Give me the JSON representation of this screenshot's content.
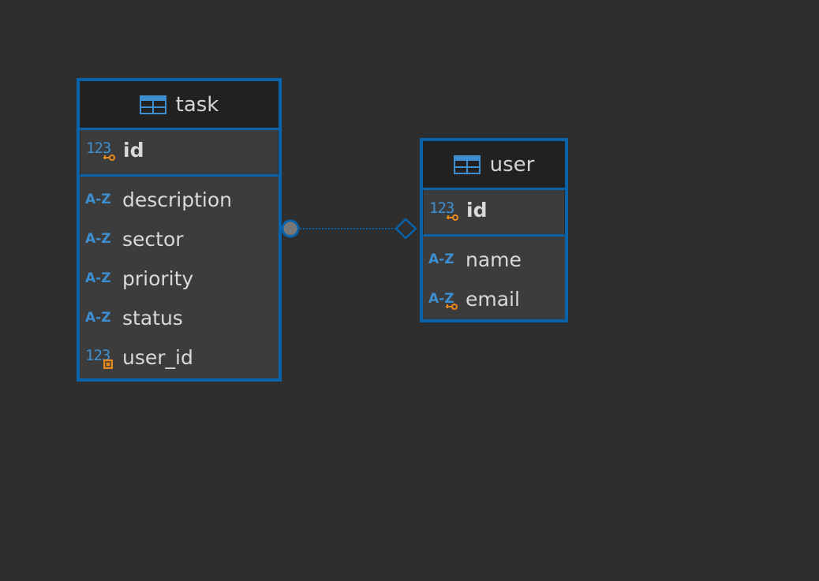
{
  "entities": {
    "task": {
      "name": "task",
      "pk": {
        "name": "id",
        "icon": "numeric-key-icon"
      },
      "columns": [
        {
          "name": "description",
          "icon": "text-type-icon"
        },
        {
          "name": "sector",
          "icon": "text-type-icon"
        },
        {
          "name": "priority",
          "icon": "text-type-icon"
        },
        {
          "name": "status",
          "icon": "text-type-icon"
        },
        {
          "name": "user_id",
          "icon": "numeric-foreign-key-icon"
        }
      ]
    },
    "user": {
      "name": "user",
      "pk": {
        "name": "id",
        "icon": "numeric-key-icon"
      },
      "columns": [
        {
          "name": "name",
          "icon": "text-type-icon"
        },
        {
          "name": "email",
          "icon": "text-key-icon"
        }
      ]
    }
  },
  "relation": {
    "from": "task.user_id",
    "to": "user.id"
  },
  "colors": {
    "background": "#2e2e2e",
    "border": "#0a62a8",
    "type_icon": "#3d8fd1",
    "key_icon": "#e8891c"
  }
}
